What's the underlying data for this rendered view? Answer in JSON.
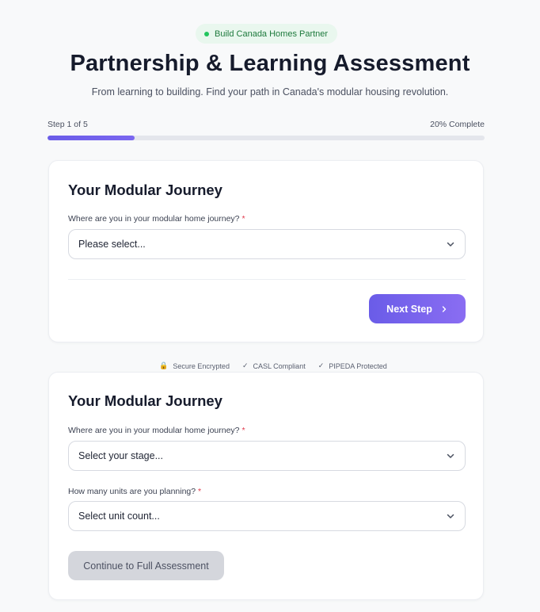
{
  "header": {
    "badge": "Build Canada Homes Partner",
    "title": "Partnership & Learning Assessment",
    "subtitle": "From learning to building. Find your path in Canada's modular housing revolution."
  },
  "progress": {
    "step_label": "Step 1 of 5",
    "complete_label": "20% Complete",
    "fraction": 0.2
  },
  "card1": {
    "heading": "Your Modular Journey",
    "question": "Where are you in your modular home journey?",
    "required_mark": "*",
    "select_value": "Please select...",
    "next_label": "Next Step",
    "next_icon": "chevron-right-icon"
  },
  "trust": {
    "secure": "Secure Encrypted",
    "casl": "CASL Compliant",
    "pipeda": "PIPEDA Protected",
    "check": "✓"
  },
  "card2": {
    "heading": "Your Modular Journey",
    "question1": "Where are you in your modular home journey?",
    "select1_value": "Select your stage...",
    "question2": "How many units are you planning?",
    "select2_value": "Select unit count...",
    "required_mark": "*",
    "continue_label": "Continue to Full Assessment"
  },
  "colors": {
    "accent": "#6a5ce8",
    "badge_green": "#22c55e",
    "required_red": "#e0394a",
    "disabled_button": "#d4d6dc"
  }
}
